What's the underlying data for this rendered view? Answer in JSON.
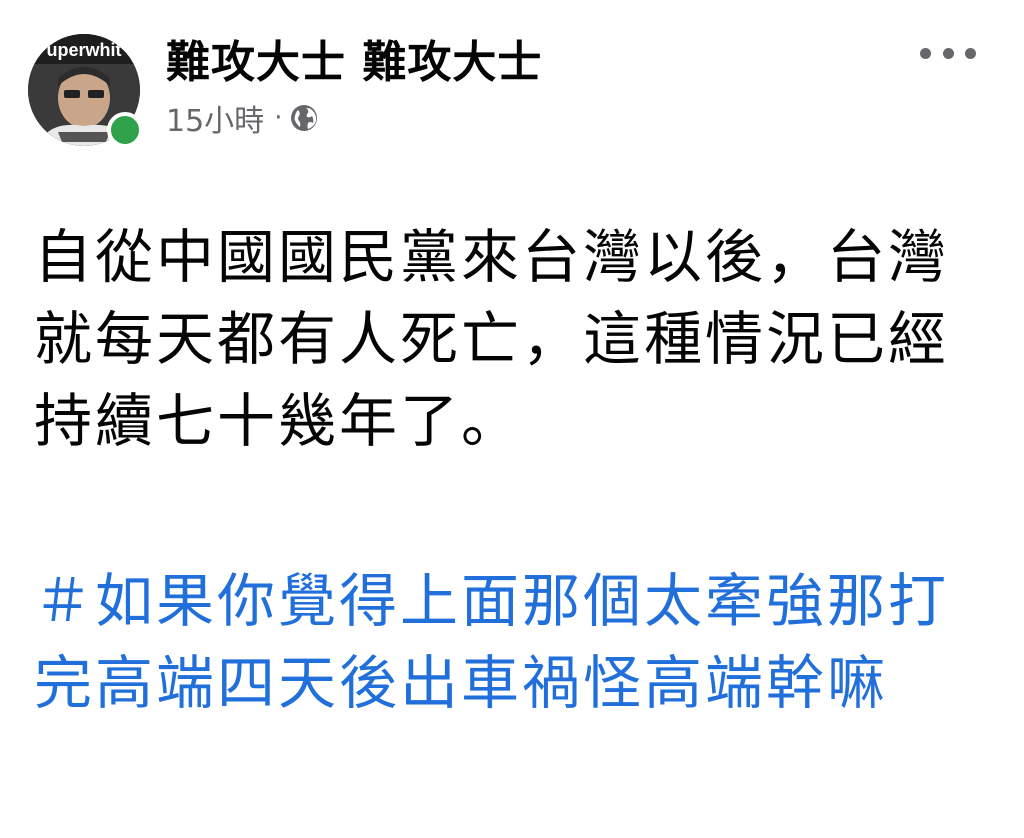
{
  "post": {
    "author_name": "難攻大士 難攻大士",
    "timestamp": "15小時",
    "separator": "·",
    "privacy_icon": "globe-icon",
    "avatar_text": "uperwhit",
    "menu_icon": "more-horizontal-icon",
    "body": "自從中國國民黨來台灣以後，台灣就每天都有人死亡，這種情況已經持續七十幾年了。",
    "hashtag": "＃如果你覺得上面那個太牽強那打完高端四天後出車禍怪高端幹嘛",
    "colors": {
      "text": "#050505",
      "secondary": "#65676b",
      "link": "#216fdb",
      "online": "#31a24c"
    }
  }
}
